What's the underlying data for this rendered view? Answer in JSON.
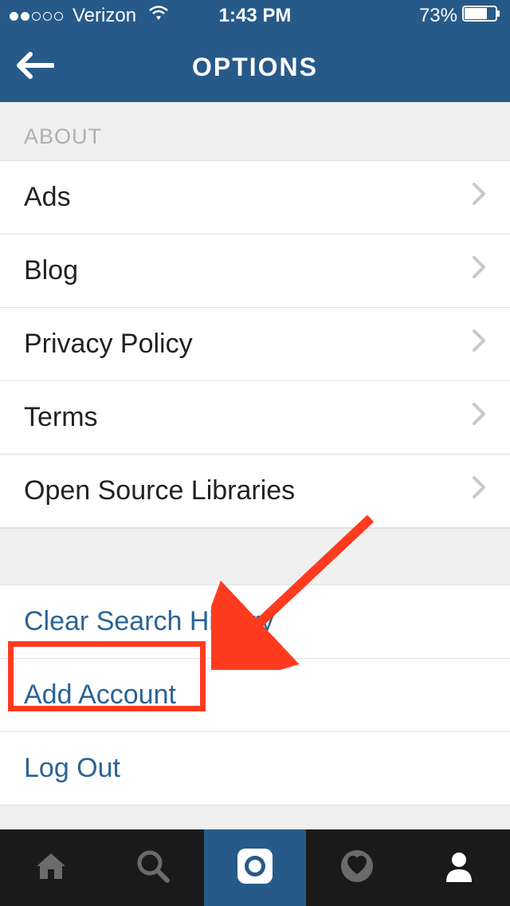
{
  "status_bar": {
    "carrier": "Verizon",
    "time": "1:43 PM",
    "battery_percent": "73%"
  },
  "nav": {
    "title": "OPTIONS"
  },
  "section_about": {
    "header": "ABOUT",
    "items": [
      {
        "label": "Ads"
      },
      {
        "label": "Blog"
      },
      {
        "label": "Privacy Policy"
      },
      {
        "label": "Terms"
      },
      {
        "label": "Open Source Libraries"
      }
    ]
  },
  "section_actions": {
    "items": [
      {
        "label": "Clear Search History"
      },
      {
        "label": "Add Account"
      },
      {
        "label": "Log Out"
      }
    ]
  }
}
